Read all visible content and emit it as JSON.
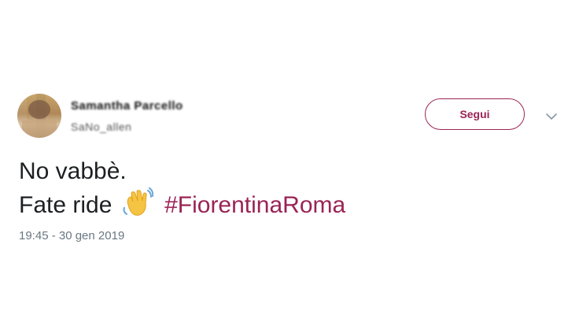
{
  "author": {
    "name": "Samantha Parcello",
    "handle": "SaNo_allen",
    "avatar_icon": "avatar-photo"
  },
  "follow_button": {
    "label": "Segui"
  },
  "menu": {
    "icon": "chevron-down-icon"
  },
  "tweet": {
    "line1": "No vabbè.",
    "line2_prefix": "Fate ride",
    "emoji": "waving-hand-emoji",
    "hashtag": "#FiorentinaRoma",
    "timestamp": "19:45 - 30 gen 2019"
  },
  "colors": {
    "accent": "#9a2355",
    "text": "#1c2022",
    "muted": "#697882",
    "emoji_yellow": "#f6c443"
  }
}
